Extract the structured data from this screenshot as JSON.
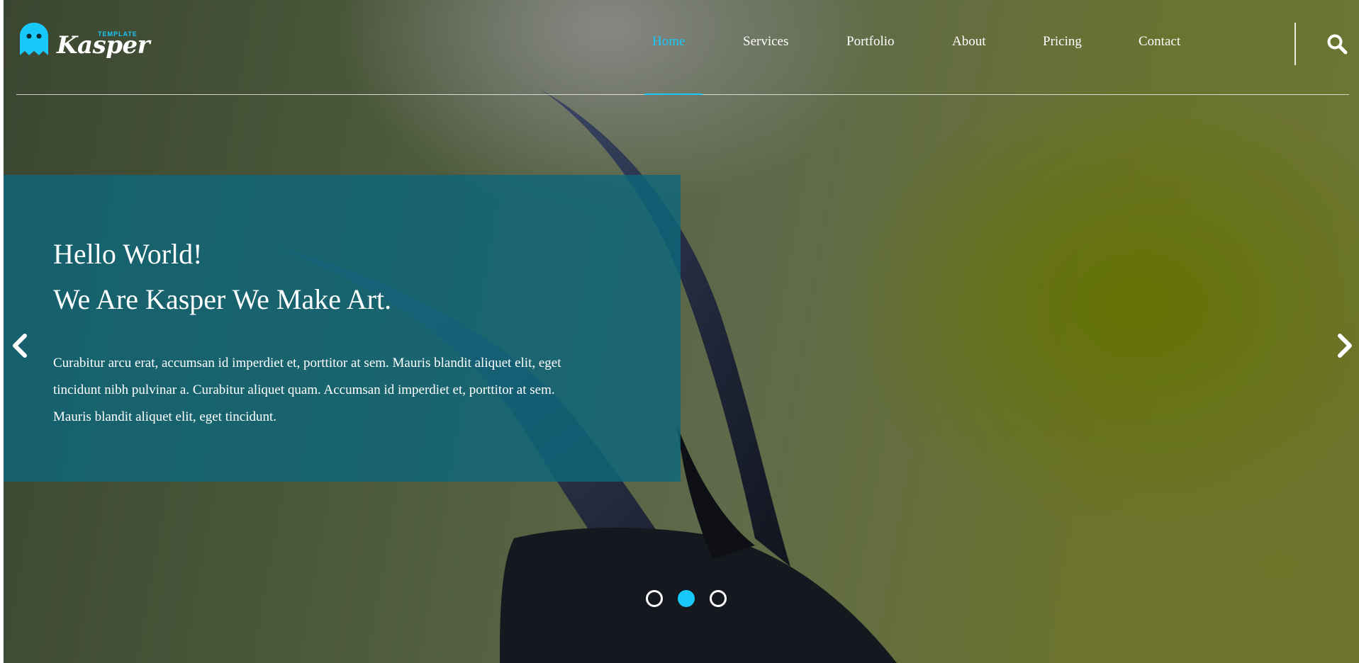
{
  "brand": {
    "name": "Kasper",
    "tagline": "TEMPLATE",
    "logo_icon": "ghost-icon",
    "accent_color": "#19c8fa"
  },
  "nav": {
    "items": [
      {
        "label": "Home",
        "active": true
      },
      {
        "label": "Services",
        "active": false
      },
      {
        "label": "Portfolio",
        "active": false
      },
      {
        "label": "About",
        "active": false
      },
      {
        "label": "Pricing",
        "active": false
      },
      {
        "label": "Contact",
        "active": false
      }
    ],
    "search_icon": "search-icon"
  },
  "hero": {
    "headline_line1": "Hello World!",
    "headline_line2": "We Are Kasper We Make Art.",
    "paragraph": "Curabitur arcu erat, accumsan id imperdiet et, porttitor at sem. Mauris blandit aliquet elit, eget tincidunt nibh pulvinar a. Curabitur aliquet quam. Accumsan id imperdiet et, porttitor at sem. Mauris blandit aliquet elit, eget tincidunt.",
    "box_color": "#0e667a",
    "prev_icon": "chevron-left-icon",
    "next_icon": "chevron-right-icon"
  },
  "slider": {
    "total": 3,
    "active_index": 1
  }
}
